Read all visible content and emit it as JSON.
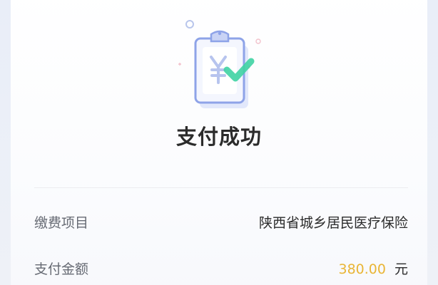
{
  "colors": {
    "background": "#eef1f8",
    "card": "#ffffff",
    "title": "#2b2b2b",
    "label": "#666a73",
    "amount": "#e9b535",
    "check": "#3fd3a3"
  },
  "result": {
    "icon": "payment-success-icon",
    "title": "支付成功"
  },
  "details": {
    "item_label": "缴费项目",
    "item_value": "陕西省城乡居民医疗保险",
    "amount_label": "支付金额",
    "amount_value": "380.00",
    "amount_unit": "元"
  }
}
